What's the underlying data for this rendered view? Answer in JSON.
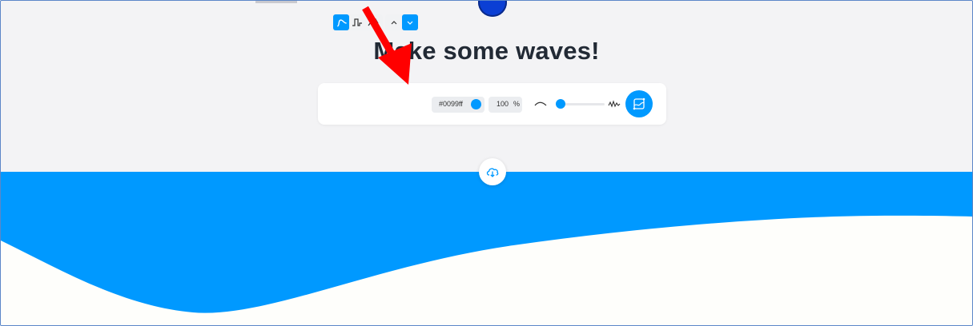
{
  "page": {
    "title": "Make some waves!",
    "colors": {
      "accent": "#0099ff",
      "background": "#f3f3f5",
      "wave": "#0099ff",
      "below_wave": "#fefefb",
      "title": "#222a35",
      "annotation_arrow": "#ff0000"
    }
  },
  "toolbar": {
    "wave_types": [
      {
        "icon": "sine-wave-icon",
        "active": true
      },
      {
        "icon": "square-wave-icon",
        "active": false
      },
      {
        "icon": "sawtooth-wave-icon",
        "active": false
      }
    ],
    "direction": [
      {
        "icon": "chevron-up-icon",
        "active": false
      },
      {
        "icon": "chevron-down-icon",
        "active": true
      }
    ],
    "color_value": "#0099ff",
    "opacity_value": "100",
    "opacity_unit": "%",
    "complexity_slider": {
      "min_icon": "smooth-wave-icon",
      "max_icon": "complex-wave-icon",
      "value_fraction": 0.09
    },
    "randomize_icon": "randomize-icon"
  },
  "download": {
    "icon": "cloud-download-icon"
  },
  "annotation": {
    "icon": "red-arrow-icon"
  }
}
